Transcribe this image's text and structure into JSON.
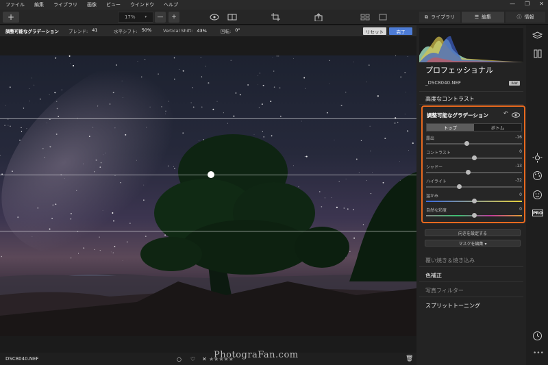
{
  "menu": [
    "ファイル",
    "編集",
    "ライブラリ",
    "画像",
    "ビュー",
    "ウインドウ",
    "ヘルプ"
  ],
  "window_controls": [
    "—",
    "❐",
    "✕"
  ],
  "toolbar": {
    "add_label": "+",
    "zoom_value": "17%",
    "zoom_out_label": "—",
    "zoom_in_label": "+",
    "tab_library": "ライブラリ",
    "tab_edit": "編集",
    "tab_info": "情報"
  },
  "subbar": {
    "title": "調整可能なグラデーション",
    "blend_label": "ブレンド:",
    "blend_value": "41",
    "hshift_label": "水平シフト:",
    "hshift_value": "50%",
    "vshift_label": "Vertical Shift:",
    "vshift_value": "43%",
    "rotation_label": "回転:",
    "rotation_value": "0°",
    "reset_label": "リセット",
    "done_label": "完了"
  },
  "panel": {
    "title": "プロフェッショナル",
    "filename": "_DSC8040.NEF",
    "raw_badge": "RAW",
    "section_contrast": "高度なコントラスト",
    "card_title": "調整可能なグラデーション",
    "seg_top": "トップ",
    "seg_bottom": "ボトム",
    "sliders": [
      {
        "label": "露出",
        "value": -16,
        "display": "-16"
      },
      {
        "label": "コントラスト",
        "value": 0,
        "display": "0"
      },
      {
        "label": "シャドー",
        "value": -13,
        "display": "-13"
      },
      {
        "label": "ハイライト",
        "value": -32,
        "display": "-32"
      },
      {
        "label": "温かみ",
        "value": 0,
        "display": "0"
      },
      {
        "label": "自然な彩度",
        "value": 0,
        "display": "0"
      }
    ],
    "orient_btn": "向きを設定する",
    "mask_btn": "マスクを編集 ▾",
    "section_dodge": "覆い焼き＆焼き込み",
    "section_color": "色補正",
    "section_photofilter": "写真フィルター",
    "section_split": "スプリットトーニング"
  },
  "bottom": {
    "filename": "DSC8040.NEF",
    "stars": "★★★★★"
  },
  "watermark": "PhotograFan.com"
}
